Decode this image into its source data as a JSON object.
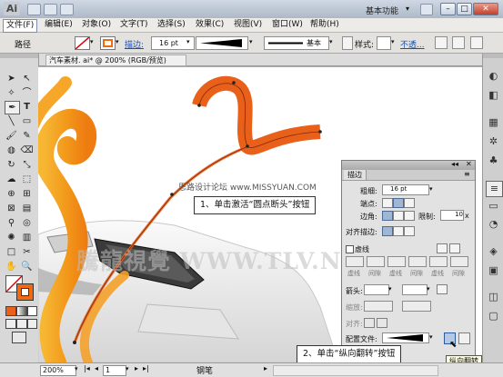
{
  "app": {
    "logo": "Ai",
    "workspace": "基本功能",
    "window_buttons": [
      "minimize",
      "maximize",
      "close"
    ]
  },
  "menus": [
    "文件(F)",
    "编辑(E)",
    "对象(O)",
    "文字(T)",
    "选择(S)",
    "效果(C)",
    "视图(V)",
    "窗口(W)",
    "帮助(H)"
  ],
  "control_bar": {
    "selection_label": "路径",
    "stroke_label": "描边:",
    "stroke_weight": "16 pt",
    "profile_label": "基本",
    "style_label": "样式:",
    "opacity_label": "不透..."
  },
  "document": {
    "tab_title": "汽车素材. ai* @ 200% (RGB/预览)"
  },
  "stroke_panel": {
    "tab": "描边",
    "weight_label": "粗细:",
    "weight_value": "16 pt",
    "cap_label": "端点:",
    "corner_label": "边角:",
    "limit_label": "限制:",
    "limit_value": "10",
    "limit_unit": "x",
    "align_label": "对齐描边:",
    "dashed_label": "虚线",
    "dash_labels": [
      "虚线",
      "间隙",
      "虚线",
      "间隙",
      "虚线",
      "间隙"
    ],
    "arrow_label": "箭头:",
    "scale_label": "缩放:",
    "align2_label": "对齐:",
    "profile_label": "配置文件:",
    "flip_tooltip": "纵向翻转"
  },
  "annotations": {
    "callout1": "1、单击激活“圆点断头”按钮",
    "callout2": "2、单击“纵向翻转”按钮",
    "watermark": "騰龍視覺 WWW.TLV.NET",
    "watermark_small": "思路设计论坛 www.MISSYUAN.COM"
  },
  "status_bar": {
    "zoom": "200%",
    "page": "1",
    "tool_name": "钢笔"
  },
  "colors": {
    "stroke_orange": "#e8601a",
    "wave_orange": "#f29a1c",
    "accent_orange": "#f26a10",
    "path_dark": "#7a2a0c"
  }
}
